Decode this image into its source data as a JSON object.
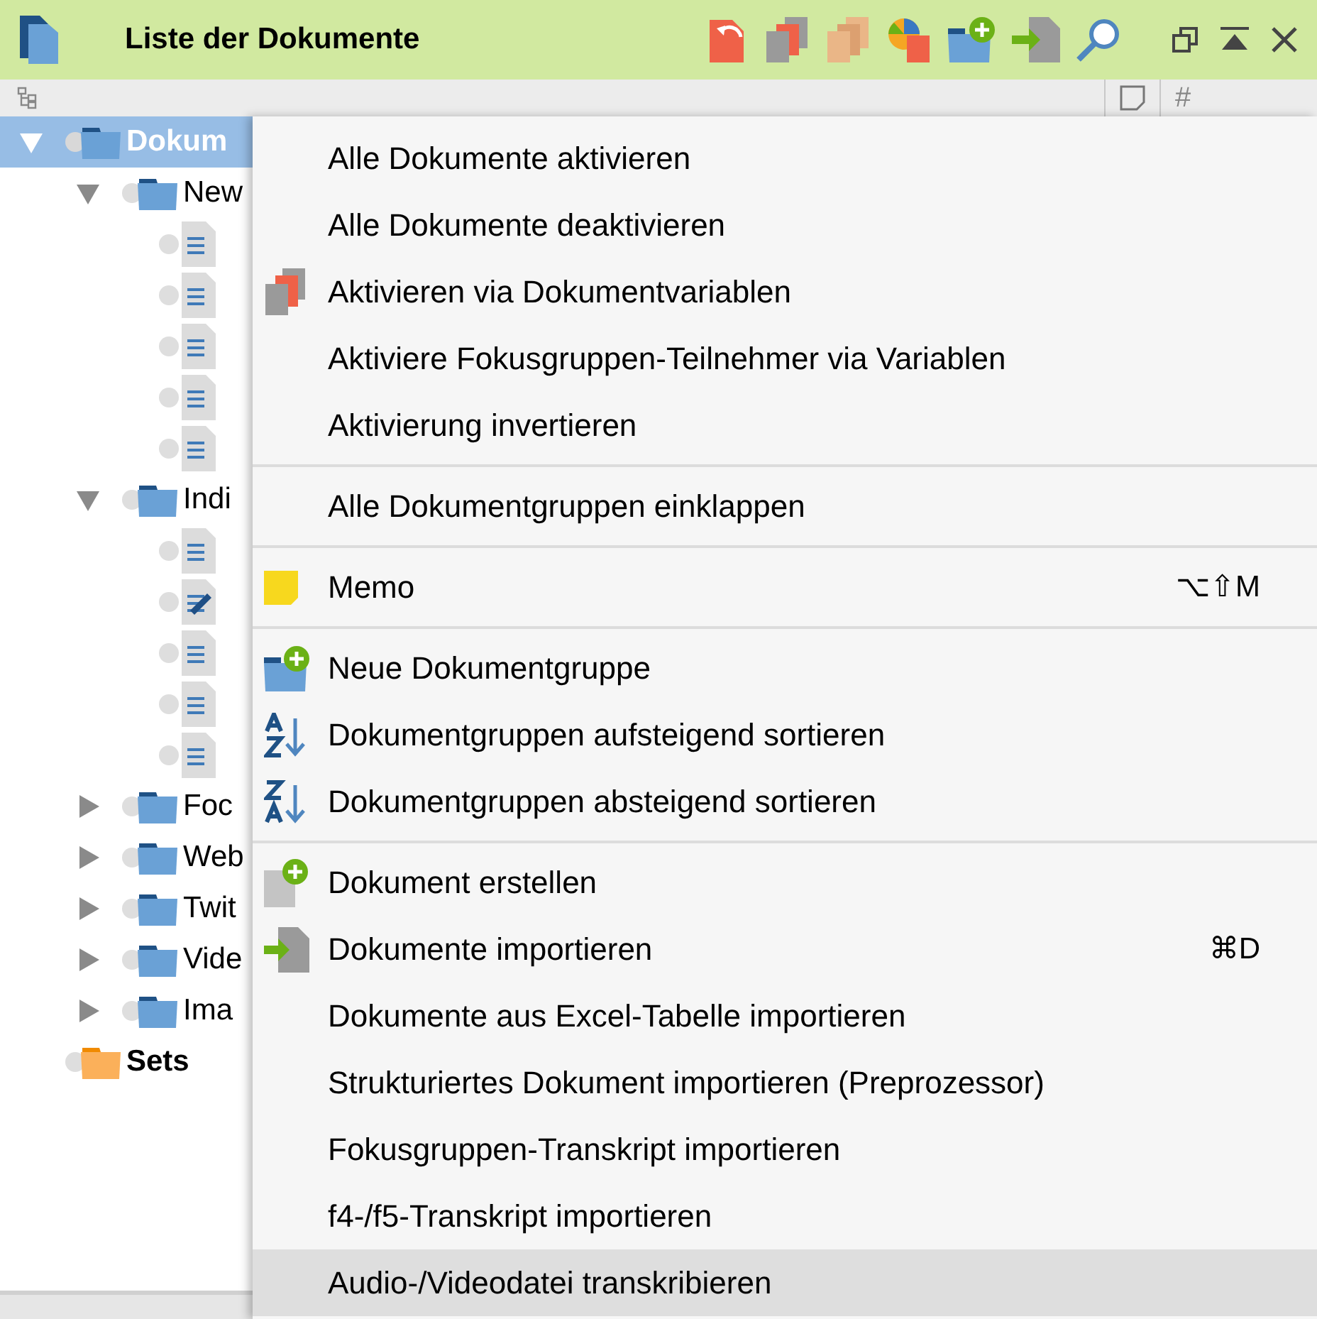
{
  "window": {
    "title": "Liste der Dokumente"
  },
  "tree": [
    {
      "kind": "folder",
      "label": "Dokum",
      "expanded": true,
      "selected": true,
      "children": [
        {
          "kind": "folder",
          "label": "New",
          "expanded": true,
          "selected": false,
          "children": [
            {
              "kind": "document",
              "edited": false,
              "selected": false
            },
            {
              "kind": "document",
              "edited": false,
              "selected": false
            },
            {
              "kind": "document",
              "edited": false,
              "selected": false
            },
            {
              "kind": "document",
              "edited": false,
              "selected": false
            },
            {
              "kind": "document",
              "edited": false,
              "selected": false
            }
          ]
        },
        {
          "kind": "folder",
          "label": "Indi",
          "expanded": true,
          "selected": false,
          "children": [
            {
              "kind": "document",
              "edited": false,
              "selected": false
            },
            {
              "kind": "document",
              "edited": true,
              "selected": false
            },
            {
              "kind": "document",
              "edited": false,
              "selected": false
            },
            {
              "kind": "document",
              "edited": false,
              "selected": false
            },
            {
              "kind": "document",
              "edited": false,
              "selected": false
            }
          ]
        },
        {
          "kind": "folder",
          "label": "Foc",
          "expanded": false,
          "selected": false
        },
        {
          "kind": "folder",
          "label": "Web",
          "expanded": false,
          "selected": false
        },
        {
          "kind": "folder",
          "label": "Twit",
          "expanded": false,
          "selected": false
        },
        {
          "kind": "folder",
          "label": "Vide",
          "expanded": false,
          "selected": false
        },
        {
          "kind": "folder",
          "label": "Ima",
          "expanded": false,
          "selected": false
        }
      ]
    },
    {
      "kind": "set",
      "label": "Sets",
      "selected": false
    }
  ],
  "context_menu": [
    {
      "kind": "item",
      "label": "Alle Dokumente aktivieren",
      "selected": false
    },
    {
      "kind": "item",
      "label": "Alle Dokumente deaktivieren",
      "selected": false
    },
    {
      "kind": "item",
      "label": "Aktivieren via Dokumentvariablen",
      "selected": false
    },
    {
      "kind": "item",
      "label": "Aktiviere Fokusgruppen-Teilnehmer via Variablen",
      "selected": false
    },
    {
      "kind": "item",
      "label": "Aktivierung invertieren",
      "selected": false
    },
    {
      "kind": "separator"
    },
    {
      "kind": "item",
      "label": "Alle Dokumentgruppen einklappen",
      "selected": false
    },
    {
      "kind": "separator"
    },
    {
      "kind": "item",
      "label": "Memo",
      "shortcut": "⌥⇧M",
      "selected": false
    },
    {
      "kind": "separator"
    },
    {
      "kind": "item",
      "label": "Neue Dokumentgruppe",
      "selected": false
    },
    {
      "kind": "item",
      "label": "Dokumentgruppen aufsteigend sortieren",
      "selected": false
    },
    {
      "kind": "item",
      "label": "Dokumentgruppen absteigend sortieren",
      "selected": false
    },
    {
      "kind": "separator"
    },
    {
      "kind": "item",
      "label": "Dokument erstellen",
      "selected": false
    },
    {
      "kind": "item",
      "label": "Dokumente importieren",
      "shortcut": "⌘D",
      "selected": false
    },
    {
      "kind": "item",
      "label": "Dokumente aus Excel-Tabelle importieren",
      "selected": false
    },
    {
      "kind": "item",
      "label": "Strukturiertes Dokument importieren (Preprozessor)",
      "selected": false
    },
    {
      "kind": "item",
      "label": "Fokusgruppen-Transkript importieren",
      "selected": false
    },
    {
      "kind": "item",
      "label": "f4-/f5-Transkript importieren",
      "selected": false
    },
    {
      "kind": "item",
      "label": "Audio-/Videodatei transkribieren",
      "selected": true
    }
  ],
  "column_headers": [
    {
      "kind": "memo"
    },
    {
      "kind": "count",
      "label": "#"
    }
  ]
}
